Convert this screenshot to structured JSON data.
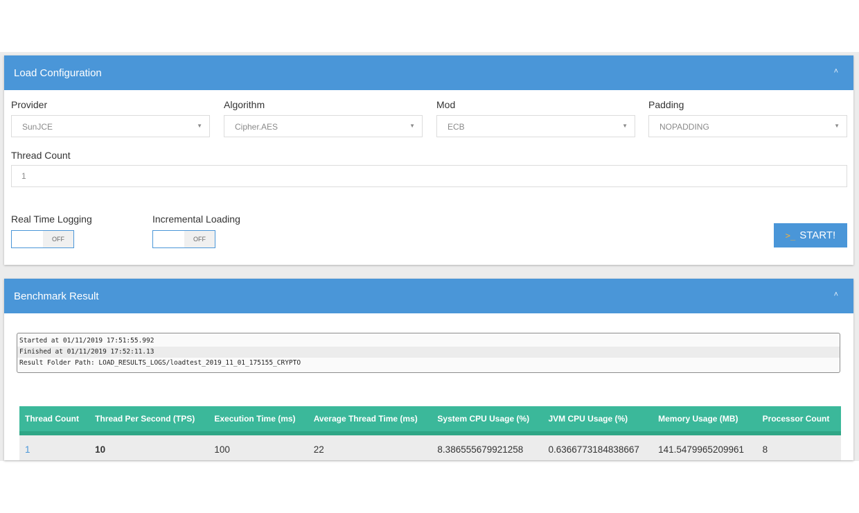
{
  "load_config": {
    "title": "Load Configuration",
    "collapse_icon": "chevron-up-icon",
    "provider": {
      "label": "Provider",
      "value": "SunJCE"
    },
    "algorithm": {
      "label": "Algorithm",
      "value": "Cipher.AES"
    },
    "mod": {
      "label": "Mod",
      "value": "ECB"
    },
    "padding": {
      "label": "Padding",
      "value": "NOPADDING"
    },
    "thread_count": {
      "label": "Thread Count",
      "value": "1"
    },
    "real_time_logging": {
      "label": "Real Time Logging",
      "state": "OFF"
    },
    "incremental_loading": {
      "label": "Incremental Loading",
      "state": "OFF"
    },
    "start_button": {
      "icon": "terminal-icon",
      "label": "START!"
    }
  },
  "benchmark": {
    "title": "Benchmark Result",
    "collapse_icon": "chevron-up-icon",
    "log_lines": [
      "Started at 01/11/2019 17:51:55.992",
      "Finished at 01/11/2019 17:52:11.13",
      "Result Folder Path: LOAD_RESULTS_LOGS/loadtest_2019_11_01_175155_CRYPTO"
    ],
    "table": {
      "headers": [
        "Thread Count",
        "Thread Per Second (TPS)",
        "Execution Time (ms)",
        "Average Thread Time (ms)",
        "System CPU Usage (%)",
        "JVM CPU Usage (%)",
        "Memory Usage (MB)",
        "Processor Count"
      ],
      "rows": [
        [
          "1",
          "10",
          "100",
          "22",
          "8.386555679921258",
          "0.6366773184838667",
          "141.5479965209961",
          "8"
        ]
      ]
    }
  },
  "colors": {
    "header_blue": "#4a96d8",
    "table_green": "#3bb89a",
    "start_icon": "#f0b040"
  }
}
